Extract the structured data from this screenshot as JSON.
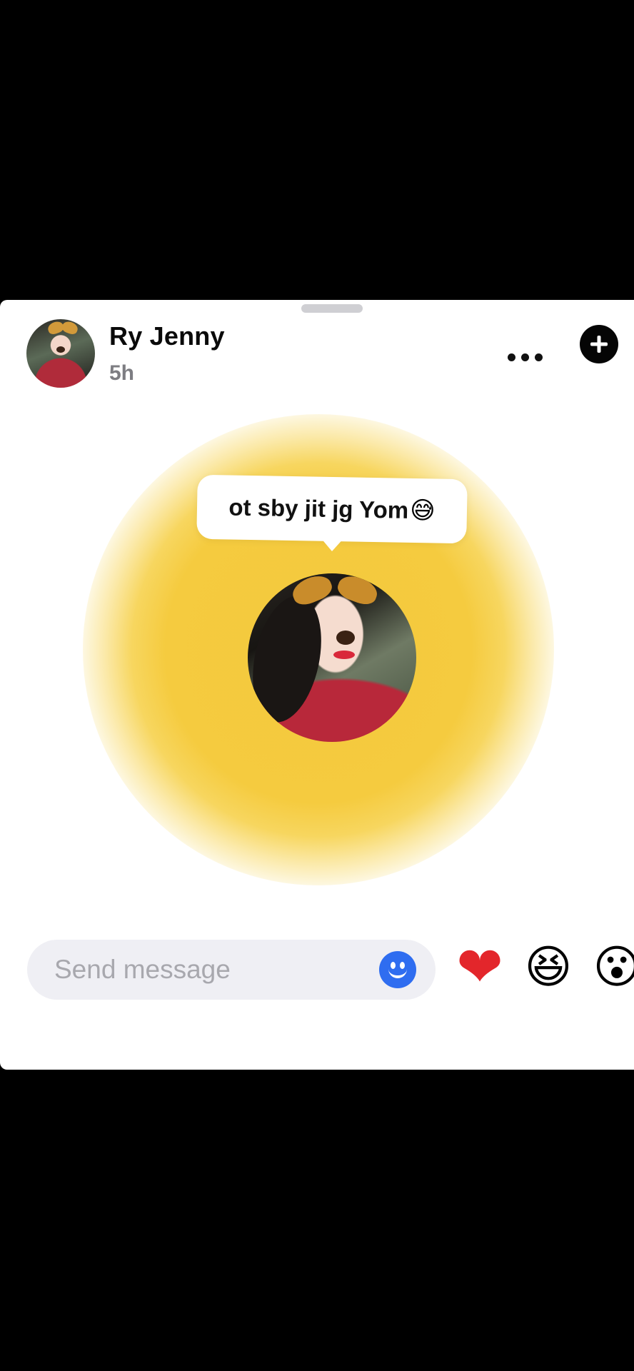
{
  "note": {
    "user_name": "Ry Jenny",
    "time_ago": "5h",
    "text": "ot sby jit jg Yom",
    "text_emoji": "😅"
  },
  "header": {
    "more_icon": "more-horizontal-icon",
    "add_icon": "plus-circle-icon",
    "add_label": "+"
  },
  "composer": {
    "placeholder": "Send message",
    "emoji_icon": "smiley-icon"
  },
  "reactions": [
    {
      "name": "heart",
      "glyph": "❤"
    },
    {
      "name": "laughing",
      "glyph": "😆"
    },
    {
      "name": "surprised",
      "glyph": "😮"
    }
  ],
  "colors": {
    "glow": "#F5CB3F",
    "emoji_button": "#2F6DF0",
    "heart": "#E3262B"
  }
}
